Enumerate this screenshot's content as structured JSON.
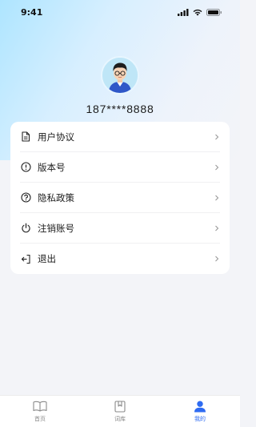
{
  "status_bar": {
    "time": "9:41"
  },
  "profile": {
    "phone": "187****8888"
  },
  "menu": {
    "items": [
      {
        "label": "用户协议",
        "icon": "document-icon"
      },
      {
        "label": "版本号",
        "icon": "info-icon"
      },
      {
        "label": "隐私政策",
        "icon": "question-icon"
      },
      {
        "label": "注销账号",
        "icon": "power-icon"
      },
      {
        "label": "退出",
        "icon": "logout-icon"
      }
    ]
  },
  "tabbar": {
    "tabs": [
      {
        "label": "首页",
        "icon": "book-open-icon",
        "active": false
      },
      {
        "label": "词库",
        "icon": "bookmark-book-icon",
        "active": false
      },
      {
        "label": "我的",
        "icon": "user-icon",
        "active": true
      }
    ]
  },
  "colors": {
    "accent": "#2e6bf2",
    "background": "#f3f4f8"
  }
}
